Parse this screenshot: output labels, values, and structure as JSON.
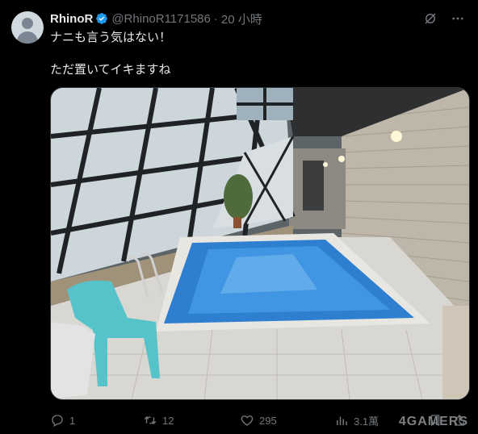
{
  "tweet": {
    "display_name": "RhinoR",
    "handle": "@RhinoR1171586",
    "separator": "·",
    "time": "20 小時",
    "text_line1": "ナニも言う気はない！",
    "text_line2": "ただ置いてイキますね",
    "verified_color": "#1d9bf0",
    "media_alt": "indoor pool with glass roof and blue plastic chair"
  },
  "actions": {
    "reply_count": "1",
    "retweet_count": "12",
    "like_count": "295",
    "views_count": "3.1萬"
  },
  "watermark": "4GAMERS",
  "icons": {
    "top_right_1": "grok-icon",
    "top_right_2": "more-icon",
    "reply": "reply-icon",
    "retweet": "retweet-icon",
    "like": "heart-icon",
    "views": "views-icon",
    "bookmark": "bookmark-icon",
    "share": "share-icon"
  }
}
